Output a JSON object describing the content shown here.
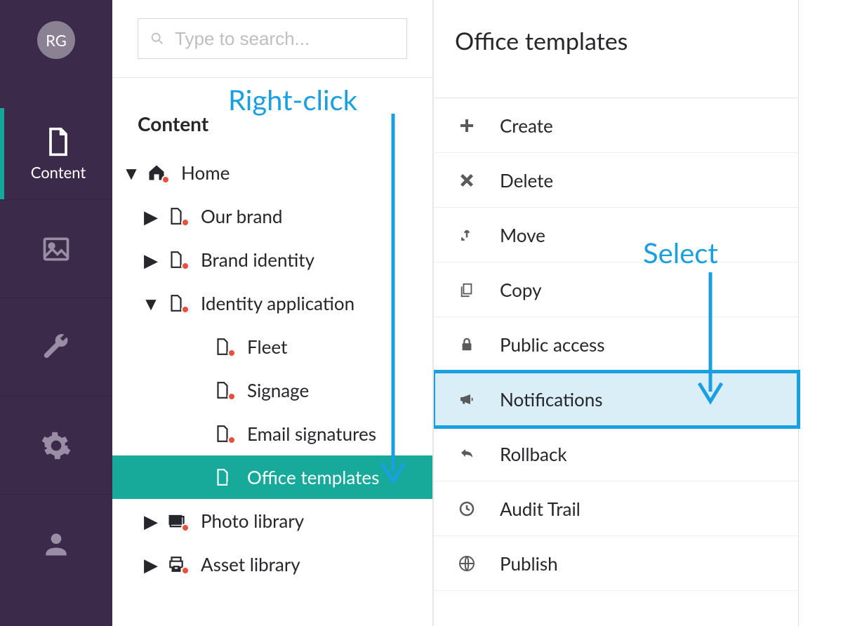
{
  "avatar": {
    "initials": "RG"
  },
  "rail": {
    "items": [
      {
        "label": "Content"
      }
    ]
  },
  "search": {
    "placeholder": "Type to search..."
  },
  "tree": {
    "section_title": "Content",
    "home": {
      "label": "Home"
    },
    "our_brand": {
      "label": "Our brand"
    },
    "brand_identity": {
      "label": "Brand identity"
    },
    "identity_app": {
      "label": "Identity application"
    },
    "fleet": {
      "label": "Fleet"
    },
    "signage": {
      "label": "Signage"
    },
    "email_sig": {
      "label": "Email signatures"
    },
    "office_templates": {
      "label": "Office templates"
    },
    "photo_library": {
      "label": "Photo library"
    },
    "asset_library": {
      "label": "Asset library"
    }
  },
  "context_menu": {
    "title": "Office templates",
    "create": "Create",
    "delete": "Delete",
    "move": "Move",
    "copy": "Copy",
    "public_access": "Public access",
    "notifications": "Notifications",
    "rollback": "Rollback",
    "audit_trail": "Audit Trail",
    "publish": "Publish"
  },
  "annotations": {
    "right_click": "Right-click",
    "select": "Select"
  }
}
